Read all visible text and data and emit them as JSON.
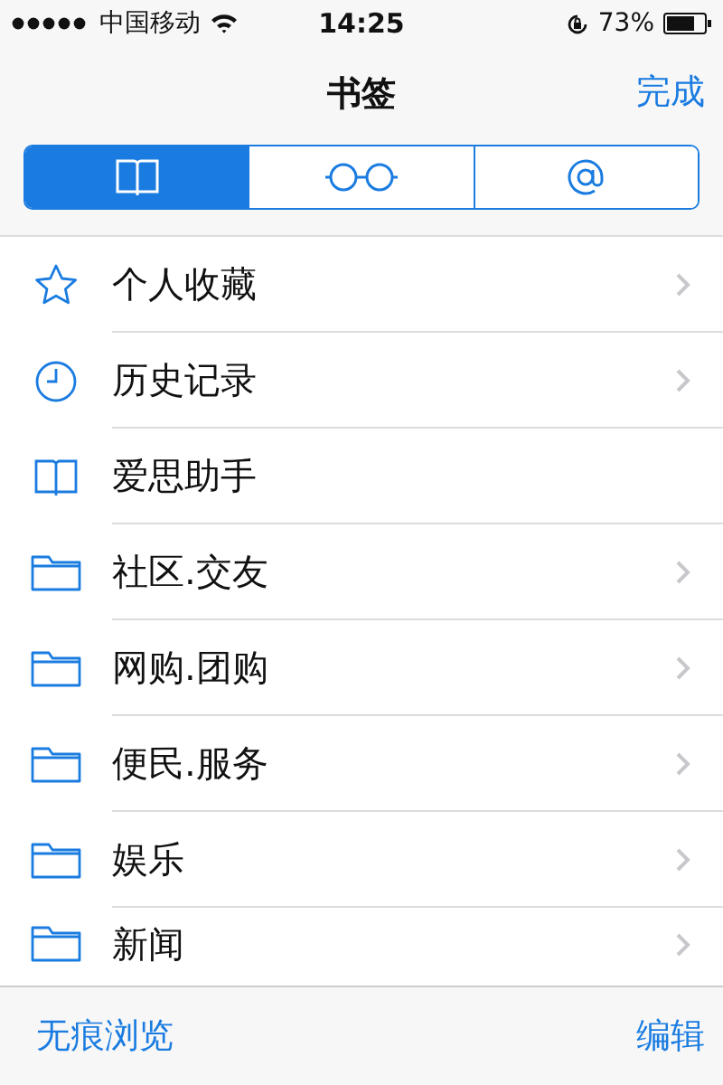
{
  "status_bar": {
    "carrier": "中国移动",
    "time": "14:25",
    "battery": "73%"
  },
  "nav_bar": {
    "title": "书签",
    "done": "完成"
  },
  "segments": [
    {
      "kind": "book",
      "selected": true
    },
    {
      "kind": "glasses",
      "selected": false
    },
    {
      "kind": "at",
      "selected": false
    }
  ],
  "items": [
    {
      "kind": "star",
      "label": "个人收藏",
      "chevron": true
    },
    {
      "kind": "clock",
      "label": "历史记录",
      "chevron": true
    },
    {
      "kind": "book",
      "label": "爱思助手",
      "chevron": false
    },
    {
      "kind": "folder",
      "label": "社区.交友",
      "chevron": true
    },
    {
      "kind": "folder",
      "label": "网购.团购",
      "chevron": true
    },
    {
      "kind": "folder",
      "label": "便民.服务",
      "chevron": true
    },
    {
      "kind": "folder",
      "label": "娱乐",
      "chevron": true
    },
    {
      "kind": "folder",
      "label": "新闻",
      "chevron": true
    }
  ],
  "toolbar": {
    "left": "无痕浏览",
    "right": "编辑"
  }
}
